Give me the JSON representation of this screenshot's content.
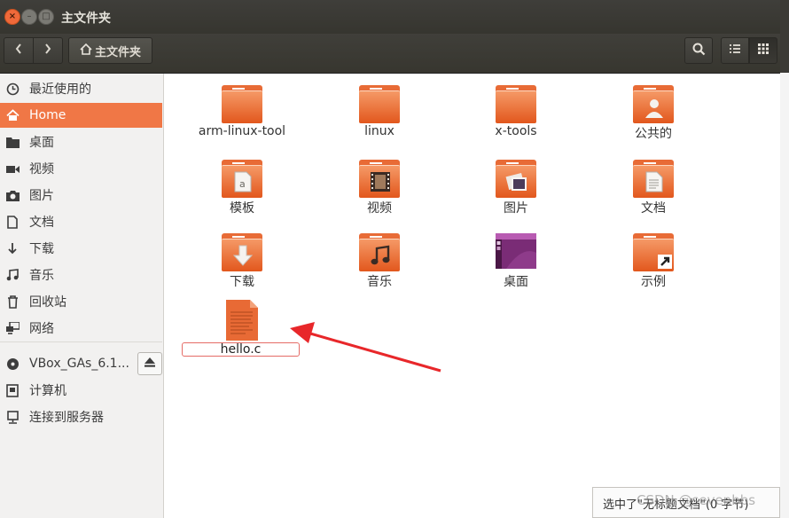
{
  "window": {
    "title": "主文件夹"
  },
  "toolbar": {
    "path_label": "主文件夹"
  },
  "sidebar": {
    "items": [
      {
        "label": "最近使用的",
        "icon": "clock-icon"
      },
      {
        "label": "Home",
        "icon": "home-icon",
        "active": true
      },
      {
        "label": "桌面",
        "icon": "folder-icon"
      },
      {
        "label": "视频",
        "icon": "video-icon"
      },
      {
        "label": "图片",
        "icon": "camera-icon"
      },
      {
        "label": "文档",
        "icon": "document-icon"
      },
      {
        "label": "下载",
        "icon": "download-icon"
      },
      {
        "label": "音乐",
        "icon": "music-icon"
      },
      {
        "label": "回收站",
        "icon": "trash-icon"
      },
      {
        "label": "网络",
        "icon": "network-icon"
      }
    ],
    "devices": [
      {
        "label": "VBox_GAs_6.1...",
        "icon": "disc-icon"
      },
      {
        "label": "计算机",
        "icon": "computer-icon"
      },
      {
        "label": "连接到服务器",
        "icon": "server-icon"
      }
    ]
  },
  "files": [
    {
      "name": "arm-linux-tool",
      "type": "folder"
    },
    {
      "name": "linux",
      "type": "folder"
    },
    {
      "name": "x-tools",
      "type": "folder"
    },
    {
      "name": "公共的",
      "type": "folder",
      "emblem": "person"
    },
    {
      "name": "模板",
      "type": "folder",
      "emblem": "template"
    },
    {
      "name": "视频",
      "type": "folder",
      "emblem": "film"
    },
    {
      "name": "图片",
      "type": "folder",
      "emblem": "photo"
    },
    {
      "name": "文档",
      "type": "folder",
      "emblem": "document"
    },
    {
      "name": "下载",
      "type": "folder",
      "emblem": "download"
    },
    {
      "name": "音乐",
      "type": "folder",
      "emblem": "music"
    },
    {
      "name": "桌面",
      "type": "desktop"
    },
    {
      "name": "示例",
      "type": "folder",
      "emblem": "link"
    },
    {
      "name": "hello.c",
      "type": "text-file",
      "renaming": true
    }
  ],
  "statusbar": {
    "text": "选中了\"无标题文档\"(0 字节)"
  },
  "watermark": "CSDN @sevenbbs",
  "colors": {
    "accent": "#f07746",
    "folder": "#e86b36",
    "titlebar": "#3c3b37",
    "arrow": "#e8272a"
  }
}
